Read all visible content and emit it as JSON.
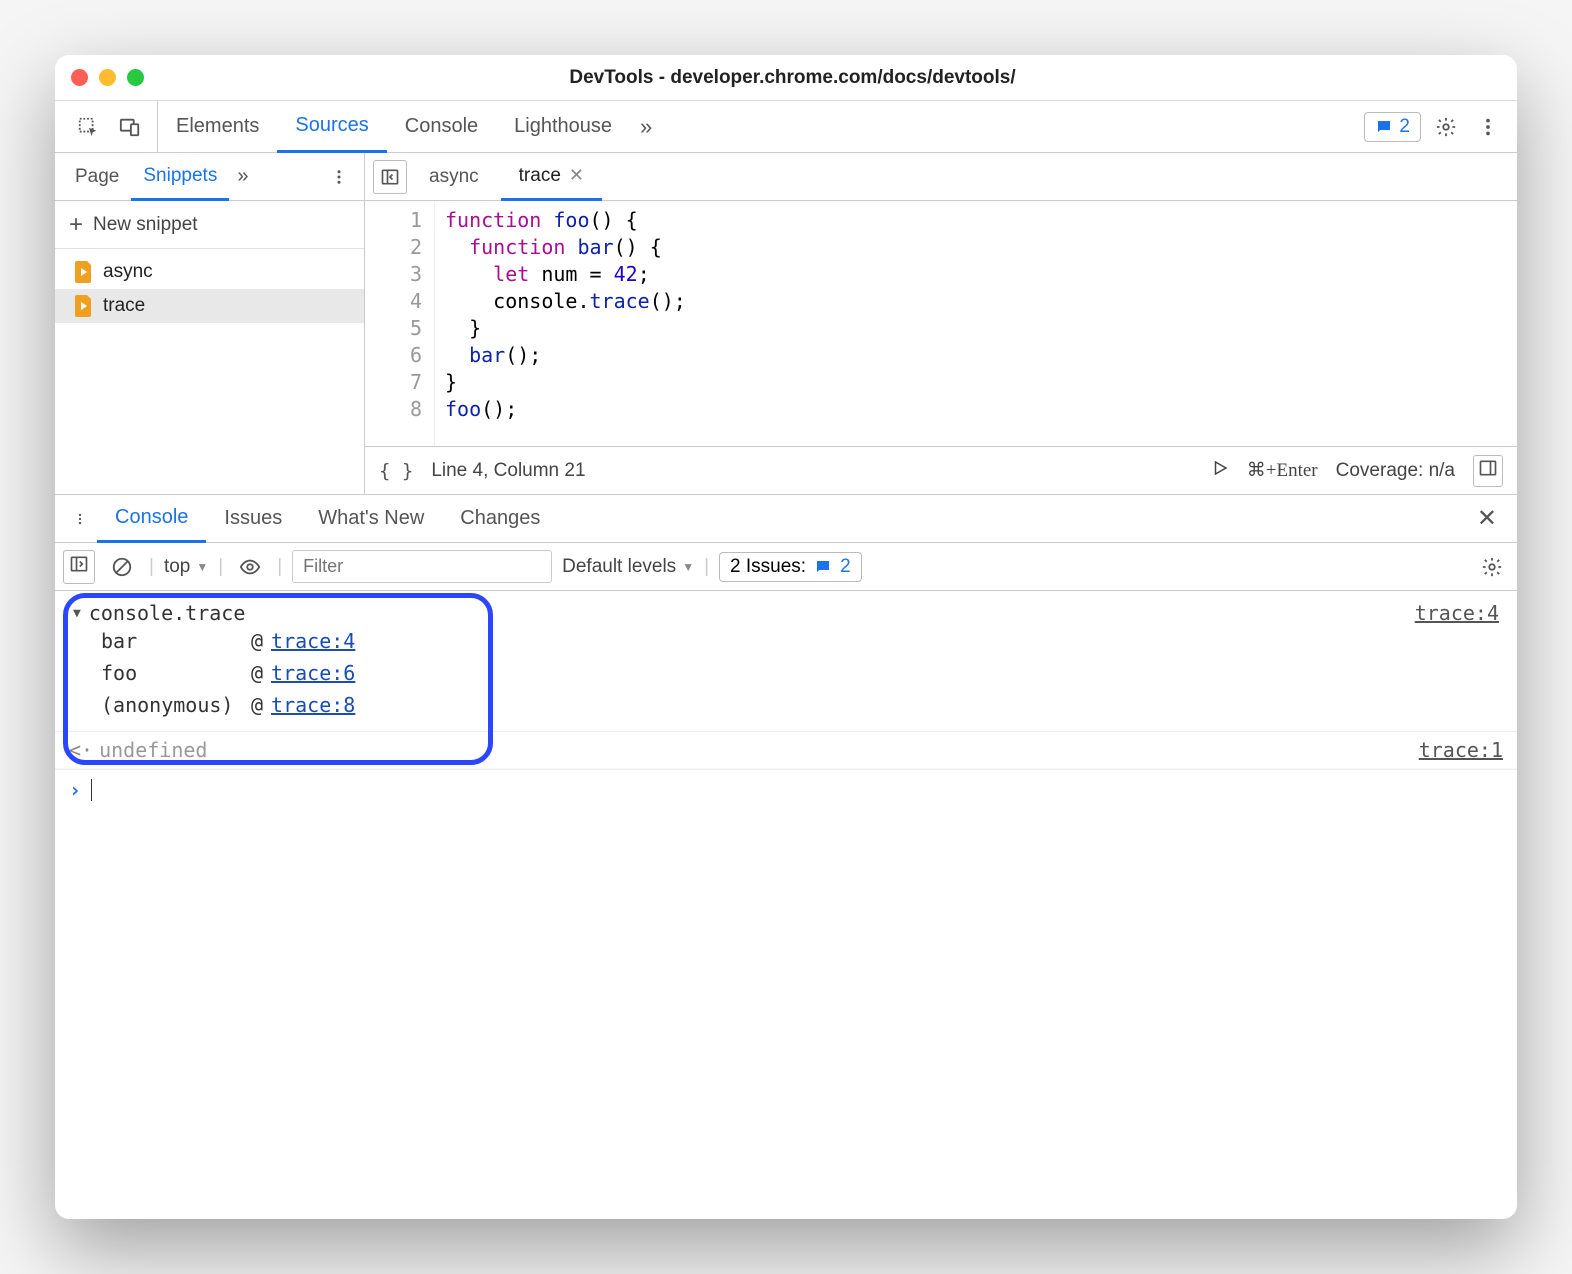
{
  "window": {
    "title": "DevTools - developer.chrome.com/docs/devtools/"
  },
  "mainTabs": {
    "items": [
      "Elements",
      "Sources",
      "Console",
      "Lighthouse"
    ],
    "activeIndex": 1,
    "issuesCount": "2"
  },
  "sidebar": {
    "tabs": [
      "Page",
      "Snippets"
    ],
    "activeIndex": 1,
    "newSnippet": "New snippet",
    "items": [
      {
        "name": "async",
        "selected": false
      },
      {
        "name": "trace",
        "selected": true
      }
    ]
  },
  "editor": {
    "tabs": [
      {
        "name": "async",
        "active": false,
        "closable": false
      },
      {
        "name": "trace",
        "active": true,
        "closable": true
      }
    ],
    "lines": [
      {
        "n": "1",
        "html": "<span class='kw'>function</span> <span class='fn'>foo</span>() {"
      },
      {
        "n": "2",
        "html": "  <span class='kw'>function</span> <span class='fn'>bar</span>() {"
      },
      {
        "n": "3",
        "html": "    <span class='kw'>let</span> <span class='ident'>num</span> = <span class='num'>42</span>;"
      },
      {
        "n": "4",
        "html": "    console.<span class='fn'>trace</span>();"
      },
      {
        "n": "5",
        "html": "  }"
      },
      {
        "n": "6",
        "html": "  <span class='fn'>bar</span>();"
      },
      {
        "n": "7",
        "html": "}"
      },
      {
        "n": "8",
        "html": "<span class='fn'>foo</span>();"
      }
    ],
    "status": {
      "pos": "Line 4, Column 21",
      "shortcut": "⌘+Enter",
      "coverage": "Coverage: n/a"
    }
  },
  "drawer": {
    "tabs": [
      "Console",
      "Issues",
      "What's New",
      "Changes"
    ],
    "activeIndex": 0
  },
  "consoleToolbar": {
    "context": "top",
    "filterPlaceholder": "Filter",
    "levels": "Default levels",
    "issuesLabel": "2 Issues:",
    "issuesCount": "2"
  },
  "consoleOutput": {
    "trace": {
      "header": "console.trace",
      "source": "trace:4",
      "stack": [
        {
          "fn": "bar",
          "link": "trace:4"
        },
        {
          "fn": "foo",
          "link": "trace:6"
        },
        {
          "fn": "(anonymous)",
          "link": "trace:8"
        }
      ]
    },
    "returnValue": {
      "value": "undefined",
      "source": "trace:1"
    }
  }
}
